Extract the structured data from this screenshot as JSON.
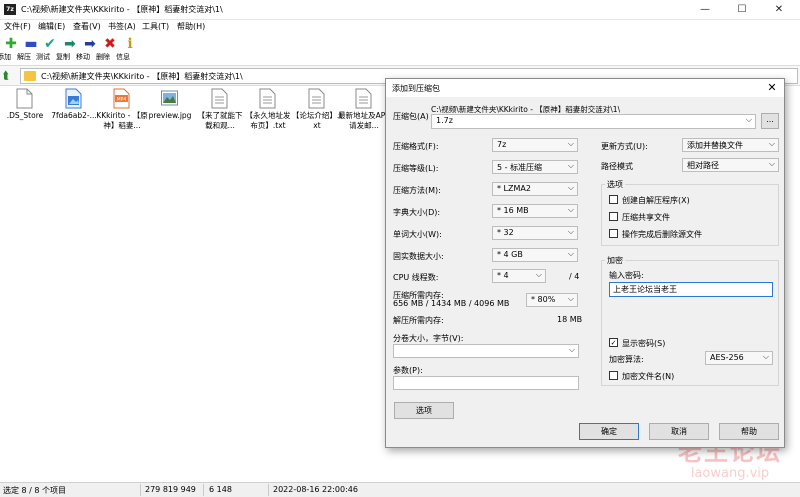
{
  "window": {
    "app_icon": "7z",
    "title": "C:\\视频\\新建文件夹\\KKkirito - 【原神】稻妻射交涟对\\1\\",
    "minimize": "—",
    "maximize": "☐",
    "close": "✕"
  },
  "menu": [
    "文件(F)",
    "编辑(E)",
    "查看(V)",
    "书签(A)",
    "工具(T)",
    "帮助(H)"
  ],
  "toolbar": [
    {
      "label": "添加",
      "icon": "add-icon",
      "glyph": "✚",
      "color": "#2eaa2e"
    },
    {
      "label": "解压",
      "icon": "extract-icon",
      "glyph": "▬",
      "color": "#2b4fbf"
    },
    {
      "label": "测试",
      "icon": "test-icon",
      "glyph": "✔",
      "color": "#1aa38a"
    },
    {
      "label": "复制",
      "icon": "copy-icon",
      "glyph": "➡",
      "color": "#1a8a6a"
    },
    {
      "label": "移动",
      "icon": "move-icon",
      "glyph": "➡",
      "color": "#1f3e9e"
    },
    {
      "label": "删除",
      "icon": "delete-icon",
      "glyph": "✖",
      "color": "#d11a1a"
    },
    {
      "label": "信息",
      "icon": "info-icon",
      "glyph": "i",
      "color": "#c89a10"
    }
  ],
  "address": {
    "path": "C:\\视频\\新建文件夹\\KKkirito - 【原神】稻妻射交涟对\\1\\"
  },
  "files": [
    {
      "name": ".DS_Store",
      "icon": "file-icon",
      "kind": "blank"
    },
    {
      "name": "7fda6ab2-...",
      "icon": "image-file-icon",
      "kind": "img"
    },
    {
      "name": "KKkirito - 【原神】稻妻...",
      "icon": "mp4-file-icon",
      "kind": "mp4"
    },
    {
      "name": "preview.jpg",
      "icon": "jpg-file-icon",
      "kind": "jpg"
    },
    {
      "name": "【来了就能下载和观...",
      "icon": "text-file-icon",
      "kind": "txt"
    },
    {
      "name": "【永久地址发布页】.txt",
      "icon": "text-file-icon",
      "kind": "txt"
    },
    {
      "name": "【论坛介绍】.txt",
      "icon": "text-file-icon",
      "kind": "txt"
    },
    {
      "name": "最新地址及APP请发邮...",
      "icon": "text-file-icon",
      "kind": "txt"
    }
  ],
  "status": {
    "selected": "选定 8 / 8 个项目",
    "size": "279 819 949",
    "packed": "6 148",
    "modified": "2022-08-16 22:00:46"
  },
  "dialog": {
    "title": "添加到压缩包",
    "archive_label": "压缩包(A)",
    "archive_path": "C:\\视频\\新建文件夹\\KKkirito - 【原神】稻妻射交涟对\\1\\",
    "archive_name": "1.7z",
    "browse": "...",
    "format_label": "压缩格式(F):",
    "format_value": "7z",
    "level_label": "压缩等级(L):",
    "level_value": "5 - 标准压缩",
    "method_label": "压缩方法(M):",
    "method_value": "* LZMA2",
    "dict_label": "字典大小(D):",
    "dict_value": "* 16 MB",
    "word_label": "单词大小(W):",
    "word_value": "* 32",
    "solid_label": "固实数据大小:",
    "solid_value": "* 4 GB",
    "cpu_label": "CPU 线程数:",
    "cpu_value": "* 4",
    "cpu_total": "/ 4",
    "mem_comp_label": "压缩所需内存:",
    "mem_comp_values": "656 MB / 1434 MB / 4096 MB",
    "mem_percent": "* 80%",
    "mem_decomp_label": "解压所需内存:",
    "mem_decomp_value": "18 MB",
    "split_label": "分卷大小，字节(V):",
    "split_value": "",
    "params_label": "参数(P):",
    "params_value": "",
    "options_button": "选项",
    "update_label": "更新方式(U):",
    "update_value": "添加并替换文件",
    "path_label": "路径模式",
    "path_value": "相对路径",
    "options_group": "选项",
    "opt_sfx": "创建自解压程序(X)",
    "opt_shared": "压缩共享文件",
    "opt_delete": "操作完成后删除源文件",
    "enc_group": "加密",
    "password_label": "输入密码:",
    "password_value": "上老王论坛当老王",
    "show_password": "显示密码(S)",
    "enc_method_label": "加密算法:",
    "enc_method_value": "AES-256",
    "enc_names": "加密文件名(N)",
    "ok": "确定",
    "cancel": "取消",
    "help": "帮助",
    "checked": "✓"
  },
  "watermark": {
    "main": "老王论坛",
    "sub": "laowang.vip"
  }
}
